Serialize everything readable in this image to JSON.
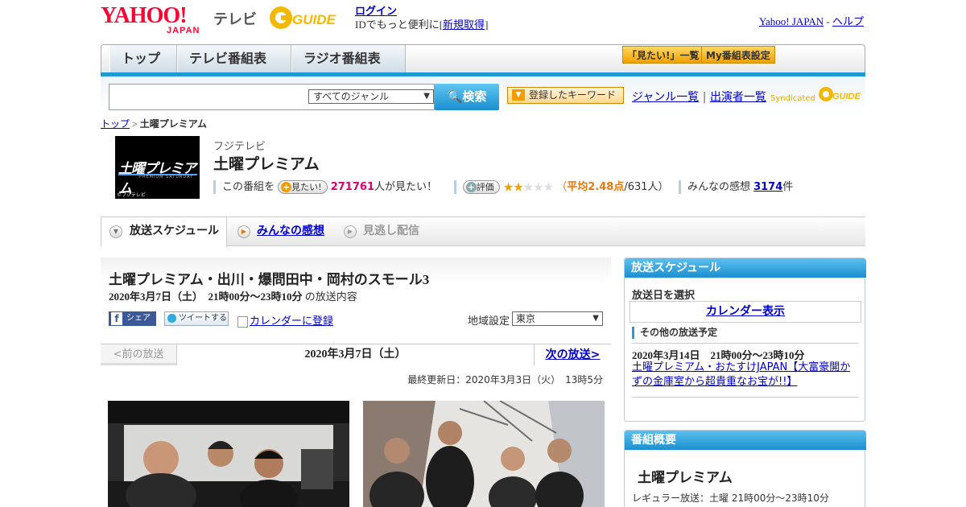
{
  "header": {
    "logo_text": "YAHOO!",
    "logo_sub": "JAPAN",
    "service": "テレビ",
    "gguide_logo": "G GUIDE",
    "login": "ログイン",
    "login_prefix": "IDでもっと便利に[",
    "register": "新規取得",
    "login_suffix": "]",
    "yahoo_japan": "Yahoo! JAPAN",
    "sep": "-",
    "help": "ヘルプ"
  },
  "nav": {
    "tabs": [
      "トップ",
      "テレビ番組表",
      "ラジオ番組表"
    ],
    "mitai_list": "「見たい!」一覧",
    "my_guide": "My番組表設定"
  },
  "search": {
    "genre": "すべてのジャンル",
    "button": "検索",
    "keyword_button": "登録したキーワード",
    "genre_list": "ジャンル一覧",
    "divider": "|",
    "performer_list": "出演者一覧",
    "syndicated": "Syndicated"
  },
  "breadcrumb": {
    "top": "トップ",
    "sep": ">",
    "current": "土曜プレミアム"
  },
  "program": {
    "thumb_title": "土曜プレミアム",
    "thumb_sub": "PREMIUM SATURDAY",
    "thumb_copy": "©フジテレビ",
    "station": "フジテレビ",
    "title": "土曜プレミアム",
    "this_program": "この番組を",
    "mitai_btn": "見たい!",
    "mitai_count": "271761",
    "mitai_suffix": "人が見たい！",
    "rate_btn": "評価",
    "rating_stars": 2,
    "avg_prefix": "（",
    "avg_label": "平均",
    "avg_value": "2.48点",
    "avg_people": "/631人）",
    "reviews_label": "みんなの感想",
    "reviews_count": "3174",
    "reviews_suffix": "件"
  },
  "tabs": {
    "schedule": "放送スケジュール",
    "reviews": "みんなの感想",
    "vod": "見逃し配信"
  },
  "episode": {
    "title": "土曜プレミアム・出川・爆問田中・岡村のスモール3",
    "date": "2020年3月7日（土）　21時00分～23時10分",
    "date_suffix": "の放送内容",
    "share": "シェア",
    "tweet": "ツイートする",
    "calendar": "カレンダーに登録",
    "region_label": "地域設定",
    "region_value": "東京",
    "prev": "<前の放送",
    "current": "2020年3月7日（土）",
    "next": "次の放送>",
    "updated": "最終更新日：2020年3月3日（火）　13時5分"
  },
  "side": {
    "schedule_head": "放送スケジュール",
    "select_date": "放送日を選択",
    "calendar_btn": "カレンダー表示",
    "other_head": "その他の放送予定",
    "other_date": "2020年3月14日　21時00分～23時10分",
    "other_prog": "土曜プレミアム・おたすけJAPAN【大富豪開かずの金庫室から超貴重なお宝が!!】",
    "overview_head": "番組概要",
    "overview_title": "土曜プレミアム",
    "regular": "レギュラー放送：土曜 21時00分～23時10分"
  },
  "colors": {
    "accent_blue": "#1e9ad6",
    "orange": "#f29c00",
    "pink": "#d6006e"
  }
}
